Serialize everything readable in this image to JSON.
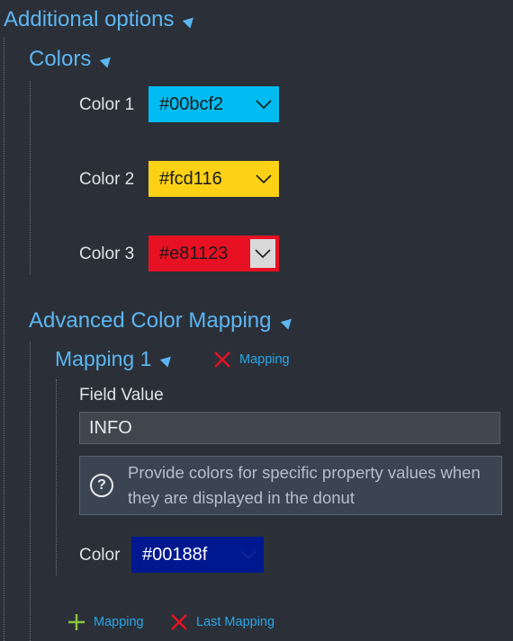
{
  "additional_options": {
    "title": "Additional options"
  },
  "colors": {
    "title": "Colors",
    "items": [
      {
        "label": "Color 1",
        "value": "#00bcf2",
        "color": "#00bcf2",
        "text_color": "#1a1a1a"
      },
      {
        "label": "Color 2",
        "value": "#fcd116",
        "color": "#fcd116",
        "text_color": "#1a1a1a"
      },
      {
        "label": "Color 3",
        "value": "#e81123",
        "color": "#e81123",
        "text_color": "#1a1a1a"
      }
    ]
  },
  "advanced_mapping": {
    "title": "Advanced Color Mapping",
    "mapping1": {
      "title": "Mapping 1",
      "remove_label": "Mapping",
      "field_label": "Field Value",
      "field_value": "INFO",
      "info_text": "Provide colors for specific property values when they are displayed in the donut",
      "color_label": "Color",
      "color_value": "#00188f",
      "color": "#00188f"
    },
    "add_label": "Mapping",
    "remove_last_label": "Last Mapping"
  },
  "icons": {
    "collapse": "triangle-collapse-icon",
    "chevron": "chevron-down-icon",
    "remove": "x-icon",
    "add": "plus-icon",
    "info": "question-circle-icon"
  },
  "theme": {
    "background": "#2b3038",
    "heading": "#5cb6f2",
    "link": "#2aa6e8",
    "remove_red": "#e81123",
    "add_green": "#8cc63e"
  }
}
